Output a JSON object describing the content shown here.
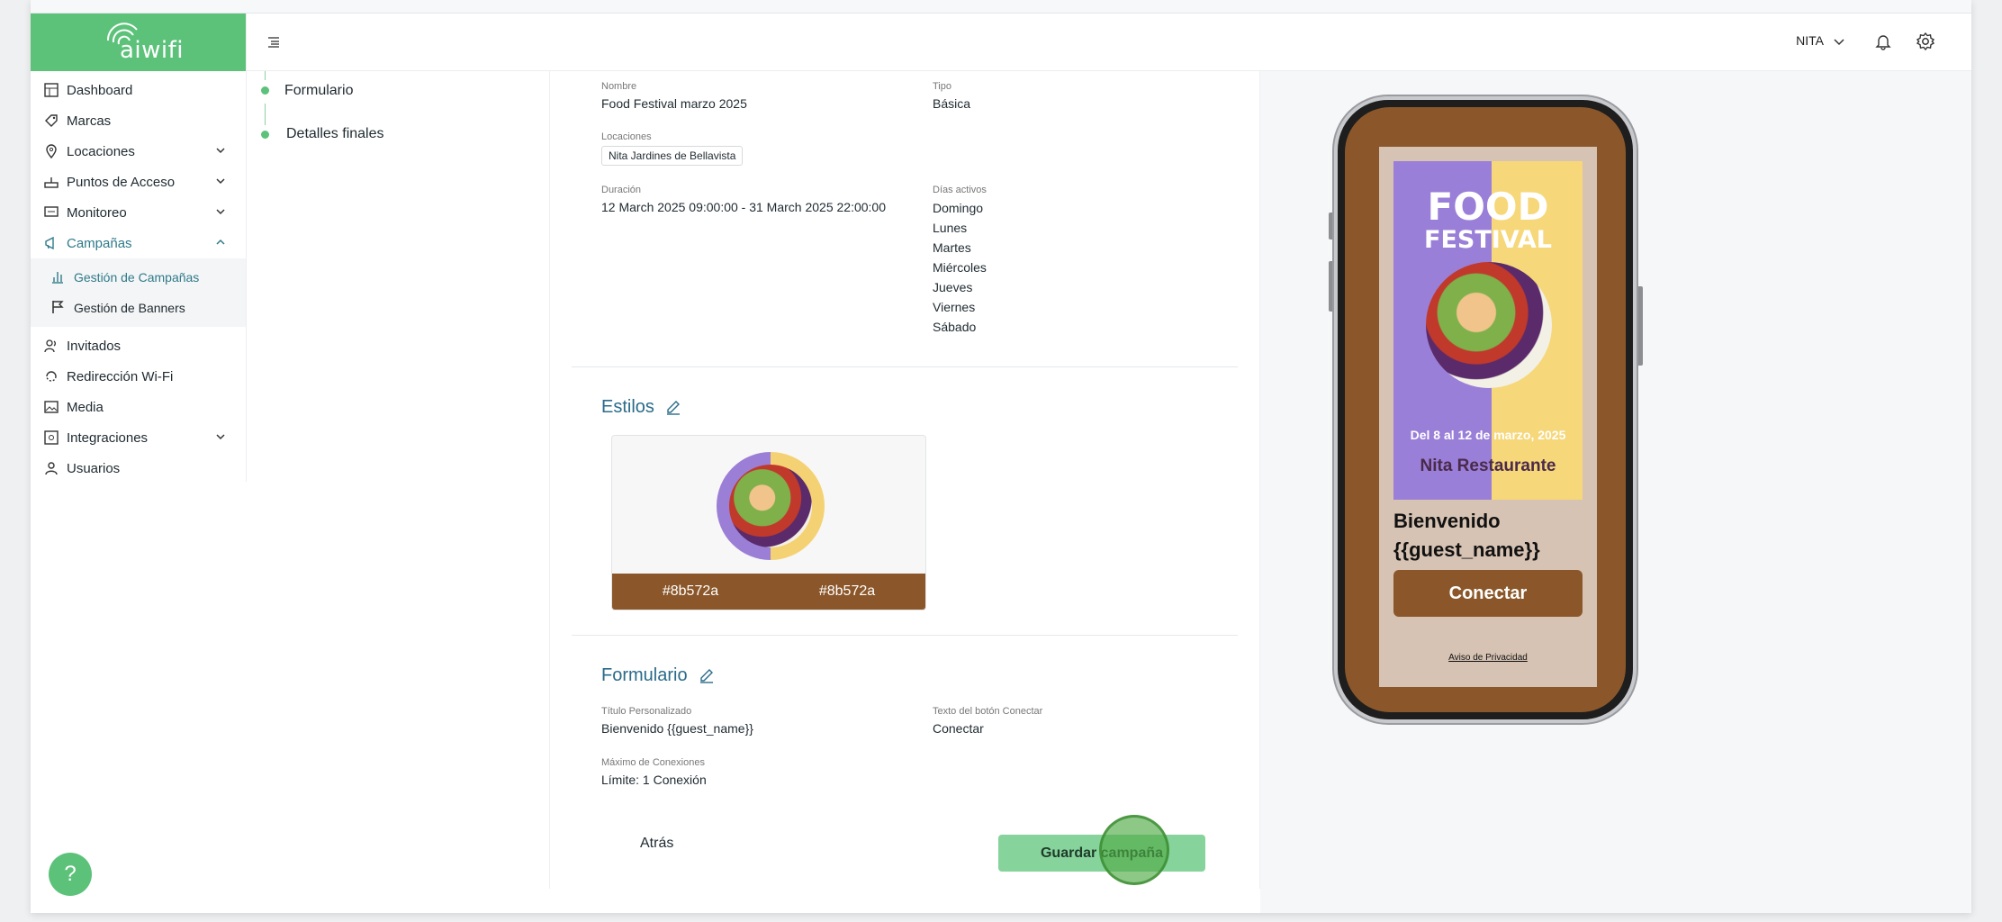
{
  "brand": {
    "logo_text": "aiwifi",
    "accent": "#5cc27a",
    "style_color": "#8b572a"
  },
  "sidebar": {
    "items": [
      {
        "label": "Dashboard",
        "icon": "dashboard-icon"
      },
      {
        "label": "Marcas",
        "icon": "tag-icon"
      },
      {
        "label": "Locaciones",
        "icon": "location-pin-icon"
      },
      {
        "label": "Puntos de Acceso",
        "icon": "router-icon"
      },
      {
        "label": "Monitoreo",
        "icon": "monitor-icon"
      },
      {
        "label": "Campañas",
        "icon": "megaphone-icon"
      },
      {
        "label": "Invitados",
        "icon": "users-icon"
      },
      {
        "label": "Redirección Wi-Fi",
        "icon": "redirect-icon"
      },
      {
        "label": "Media",
        "icon": "image-icon"
      },
      {
        "label": "Integraciones",
        "icon": "integrations-icon"
      },
      {
        "label": "Usuarios",
        "icon": "user-icon"
      }
    ],
    "sub_items": [
      {
        "label": "Gestión de Campañas",
        "icon": "bar-chart-icon"
      },
      {
        "label": "Gestión de Banners",
        "icon": "flag-icon"
      }
    ]
  },
  "header": {
    "user": "NITA"
  },
  "stepper": {
    "steps": [
      "Formulario",
      "Detalles finales"
    ]
  },
  "details": {
    "nombre_label": "Nombre",
    "nombre": "Food Festival marzo 2025",
    "tipo_label": "Tipo",
    "tipo": "Básica",
    "locaciones_label": "Locaciones",
    "locacion": "Nita Jardines de Bellavista",
    "duracion_label": "Duración",
    "duracion": "12 March 2025 09:00:00 - 31 March 2025 22:00:00",
    "dias_label": "Días activos",
    "dias": [
      "Domingo",
      "Lunes",
      "Martes",
      "Miércoles",
      "Jueves",
      "Viernes",
      "Sábado"
    ]
  },
  "estilos": {
    "title": "Estilos",
    "color1": "#8b572a",
    "color2": "#8b572a"
  },
  "formulario": {
    "title": "Formulario",
    "titulo_label": "Título Personalizado",
    "titulo": "Bienvenido {{guest_name}}",
    "boton_label": "Texto del botón Conectar",
    "boton": "Conectar",
    "max_label": "Máximo de Conexiones",
    "max": "Límite: 1 Conexión"
  },
  "actions": {
    "back": "Atrás",
    "save": "Guardar campaña"
  },
  "phone": {
    "poster_line1": "FOOD",
    "poster_line2": "FESTIVAL",
    "poster_date": "Del 8 al 12 de marzo, 2025",
    "poster_restaurant": "Nita Restaurante",
    "welcome": "Bienvenido {{guest_name}}",
    "connect": "Conectar",
    "privacy": "Aviso de Privacidad"
  },
  "help": {
    "label": "?"
  }
}
